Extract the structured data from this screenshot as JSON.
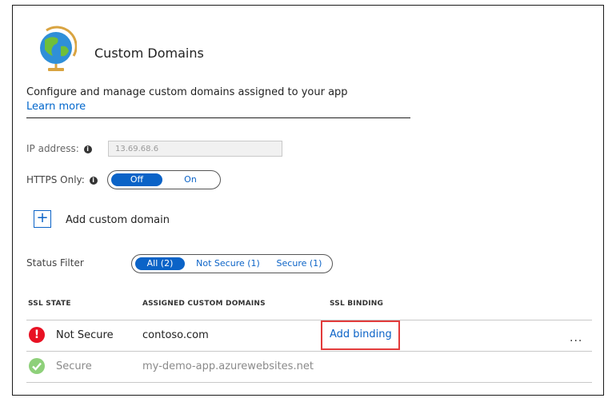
{
  "header": {
    "title": "Custom Domains",
    "icon": "globe-icon"
  },
  "intro": {
    "description": "Configure and manage custom domains assigned to your app",
    "learn_more": "Learn more"
  },
  "ip": {
    "label": "IP address:",
    "value": "13.69.68.6"
  },
  "https": {
    "label": "HTTPS Only:",
    "off_label": "Off",
    "on_label": "On",
    "selected": "Off"
  },
  "add_domain": {
    "label": "Add custom domain",
    "icon": "plus-icon"
  },
  "status_filter": {
    "label": "Status Filter",
    "options": [
      "All (2)",
      "Not Secure (1)",
      "Secure (1)"
    ],
    "selected": "All (2)"
  },
  "table": {
    "columns": [
      "SSL STATE",
      "ASSIGNED CUSTOM DOMAINS",
      "SSL BINDING"
    ],
    "rows": [
      {
        "state": "Not Secure",
        "domain": "contoso.com",
        "binding": "Add binding",
        "more": "..."
      },
      {
        "state": "Secure",
        "domain": "my-demo-app.azurewebsites.net",
        "binding": ""
      }
    ]
  },
  "colors": {
    "accent": "#0b63c7",
    "error": "#e81123",
    "success": "#8ed07a",
    "highlight": "#e23b3b"
  }
}
